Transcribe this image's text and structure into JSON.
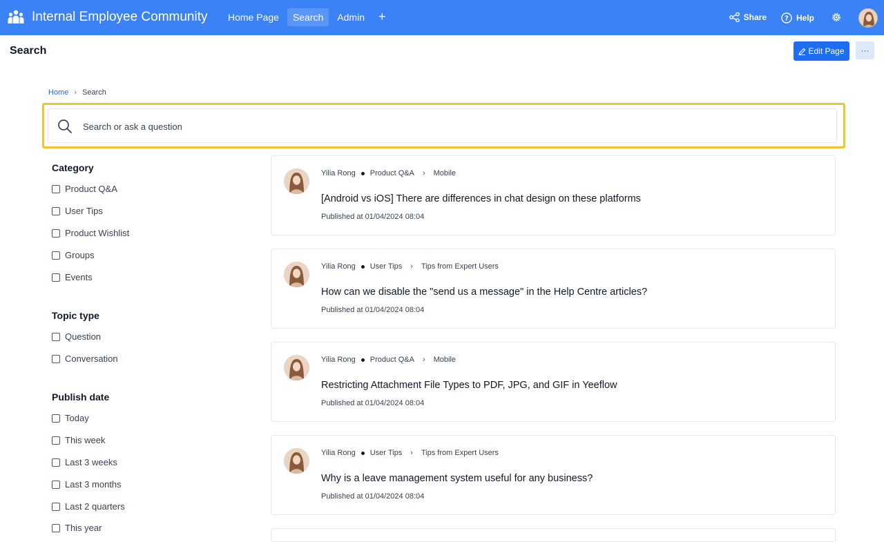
{
  "app": {
    "title": "Internal Employee Community"
  },
  "nav": {
    "items": [
      "Home Page",
      "Search",
      "Admin"
    ],
    "active": "Search",
    "add_label": "+"
  },
  "actions": {
    "share": "Share",
    "help": "Help"
  },
  "page": {
    "title": "Search",
    "edit_label": "Edit Page",
    "more_label": "···"
  },
  "breadcrumb": {
    "home": "Home",
    "current": "Search"
  },
  "search": {
    "placeholder": "Search or ask a question"
  },
  "filters": {
    "category": {
      "title": "Category",
      "options": [
        "Product Q&A",
        "User Tips",
        "Product Wishlist",
        "Groups",
        "Events"
      ]
    },
    "topic_type": {
      "title": "Topic type",
      "options": [
        "Question",
        "Conversation"
      ]
    },
    "publish_date": {
      "title": "Publish date",
      "options": [
        "Today",
        "This week",
        "Last 3 weeks",
        "Last 3 months",
        "Last 2 quarters",
        "This year"
      ]
    }
  },
  "results": [
    {
      "author": "Yilia Rong",
      "category": "Product Q&A",
      "subcategory": "Mobile",
      "title": "[Android vs iOS] There are differences in chat design on these platforms",
      "date": "Published at 01/04/2024 08:04"
    },
    {
      "author": "Yilia Rong",
      "category": "User Tips",
      "subcategory": "Tips from Expert Users",
      "title": "How can we disable the \"send us a message\" in the Help Centre articles?",
      "date": "Published at 01/04/2024 08:04"
    },
    {
      "author": "Yilia Rong",
      "category": "Product Q&A",
      "subcategory": "Mobile",
      "title": "Restricting Attachment File Types to PDF, JPG, and GIF in Yeeflow",
      "date": "Published at 01/04/2024 08:04"
    },
    {
      "author": "Yilia Rong",
      "category": "User Tips",
      "subcategory": "Tips from Expert Users",
      "title": "Why is a leave management system useful for any business?",
      "date": "Published at 01/04/2024 08:04"
    }
  ],
  "colors": {
    "topbar": "#3b82f6",
    "accent": "#1d6ef0",
    "search_highlight": "#f2c230"
  }
}
